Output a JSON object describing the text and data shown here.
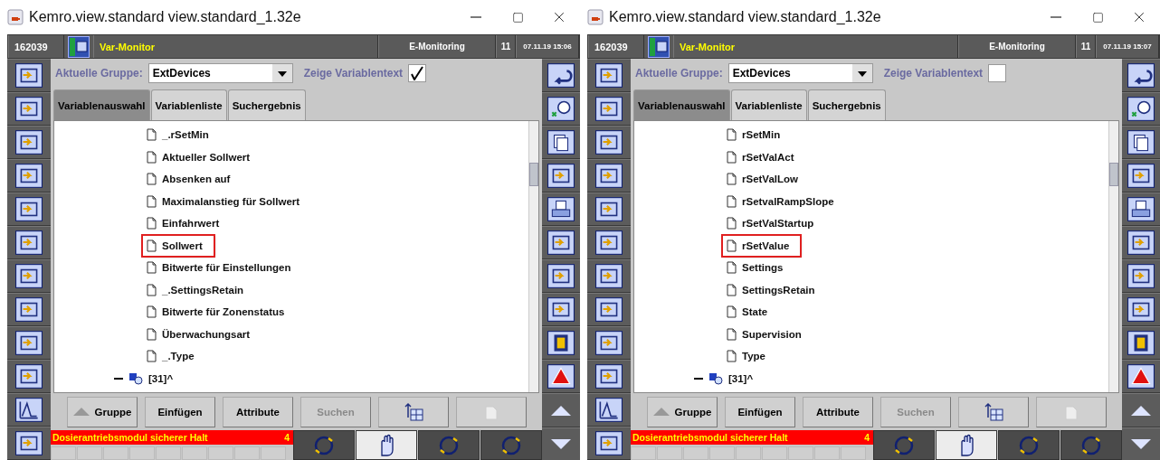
{
  "windows": [
    {
      "title": "Kemro.view.standard view.standard_1.32e",
      "header": {
        "id": "162039",
        "module": "Var-Monitor",
        "mode": "E-Monitoring",
        "count": "11",
        "datetime": "07.11.19 15:06"
      },
      "group": {
        "label": "Aktuelle Gruppe:",
        "value": "ExtDevices"
      },
      "show_text": {
        "label": "Zeige Variablentext",
        "checked": true
      },
      "tabs": [
        {
          "label": "Variablenauswahl",
          "selected": true
        },
        {
          "label": "Variablenliste",
          "selected": false
        },
        {
          "label": "Suchergebnis",
          "selected": false
        }
      ],
      "tree": {
        "items": [
          {
            "label": "_.rSetMin",
            "highlighted": false
          },
          {
            "label": "Aktueller Sollwert",
            "highlighted": false
          },
          {
            "label": "Absenken auf",
            "highlighted": false
          },
          {
            "label": "Maximalanstieg für Sollwert",
            "highlighted": false
          },
          {
            "label": "Einfahrwert",
            "highlighted": false
          },
          {
            "label": "Sollwert",
            "highlighted": true
          },
          {
            "label": "Bitwerte für Einstellungen",
            "highlighted": false
          },
          {
            "label": "_.SettingsRetain",
            "highlighted": false
          },
          {
            "label": "Bitwerte für Zonenstatus",
            "highlighted": false
          },
          {
            "label": "Überwachungsart",
            "highlighted": false
          },
          {
            "label": "_.Type",
            "highlighted": false
          }
        ],
        "parent": {
          "label": "[31]^",
          "expanded": true
        }
      },
      "buttons": [
        {
          "kind": "up",
          "label": "Gruppe",
          "disabled": false
        },
        {
          "kind": "text",
          "label": "Einfügen",
          "disabled": false
        },
        {
          "kind": "text",
          "label": "Attribute",
          "disabled": false
        },
        {
          "kind": "text",
          "label": "Suchen",
          "disabled": true
        },
        {
          "kind": "tree",
          "disabled": false
        },
        {
          "kind": "doc",
          "disabled": true
        }
      ],
      "alarm": {
        "text": "Dosierantriebsmodul  sicherer Halt",
        "count": "4"
      },
      "mode_buttons": [
        {
          "selected": false
        },
        {
          "selected": true
        },
        {
          "selected": false
        },
        {
          "selected": false
        }
      ]
    },
    {
      "title": "Kemro.view.standard view.standard_1.32e",
      "header": {
        "id": "162039",
        "module": "Var-Monitor",
        "mode": "E-Monitoring",
        "count": "11",
        "datetime": "07.11.19 15:07"
      },
      "group": {
        "label": "Aktuelle Gruppe:",
        "value": "ExtDevices"
      },
      "show_text": {
        "label": "Zeige Variablentext",
        "checked": false
      },
      "tabs": [
        {
          "label": "Variablenauswahl",
          "selected": true
        },
        {
          "label": "Variablenliste",
          "selected": false
        },
        {
          "label": "Suchergebnis",
          "selected": false
        }
      ],
      "tree": {
        "items": [
          {
            "label": "rSetMin",
            "highlighted": false
          },
          {
            "label": "rSetValAct",
            "highlighted": false
          },
          {
            "label": "rSetValLow",
            "highlighted": false
          },
          {
            "label": "rSetvalRampSlope",
            "highlighted": false
          },
          {
            "label": "rSetValStartup",
            "highlighted": false
          },
          {
            "label": "rSetValue",
            "highlighted": true
          },
          {
            "label": "Settings",
            "highlighted": false
          },
          {
            "label": "SettingsRetain",
            "highlighted": false
          },
          {
            "label": "State",
            "highlighted": false
          },
          {
            "label": "Supervision",
            "highlighted": false
          },
          {
            "label": "Type",
            "highlighted": false
          }
        ],
        "parent": {
          "label": "[31]^",
          "expanded": true
        }
      },
      "buttons": [
        {
          "kind": "up",
          "label": "Gruppe",
          "disabled": false
        },
        {
          "kind": "text",
          "label": "Einfügen",
          "disabled": false
        },
        {
          "kind": "text",
          "label": "Attribute",
          "disabled": false
        },
        {
          "kind": "text",
          "label": "Suchen",
          "disabled": true
        },
        {
          "kind": "tree",
          "disabled": false
        },
        {
          "kind": "doc",
          "disabled": true
        }
      ],
      "alarm": {
        "text": "Dosierantriebsmodul  sicherer Halt",
        "count": "4"
      },
      "mode_buttons": [
        {
          "selected": false
        },
        {
          "selected": true
        },
        {
          "selected": false
        },
        {
          "selected": false
        }
      ]
    }
  ]
}
